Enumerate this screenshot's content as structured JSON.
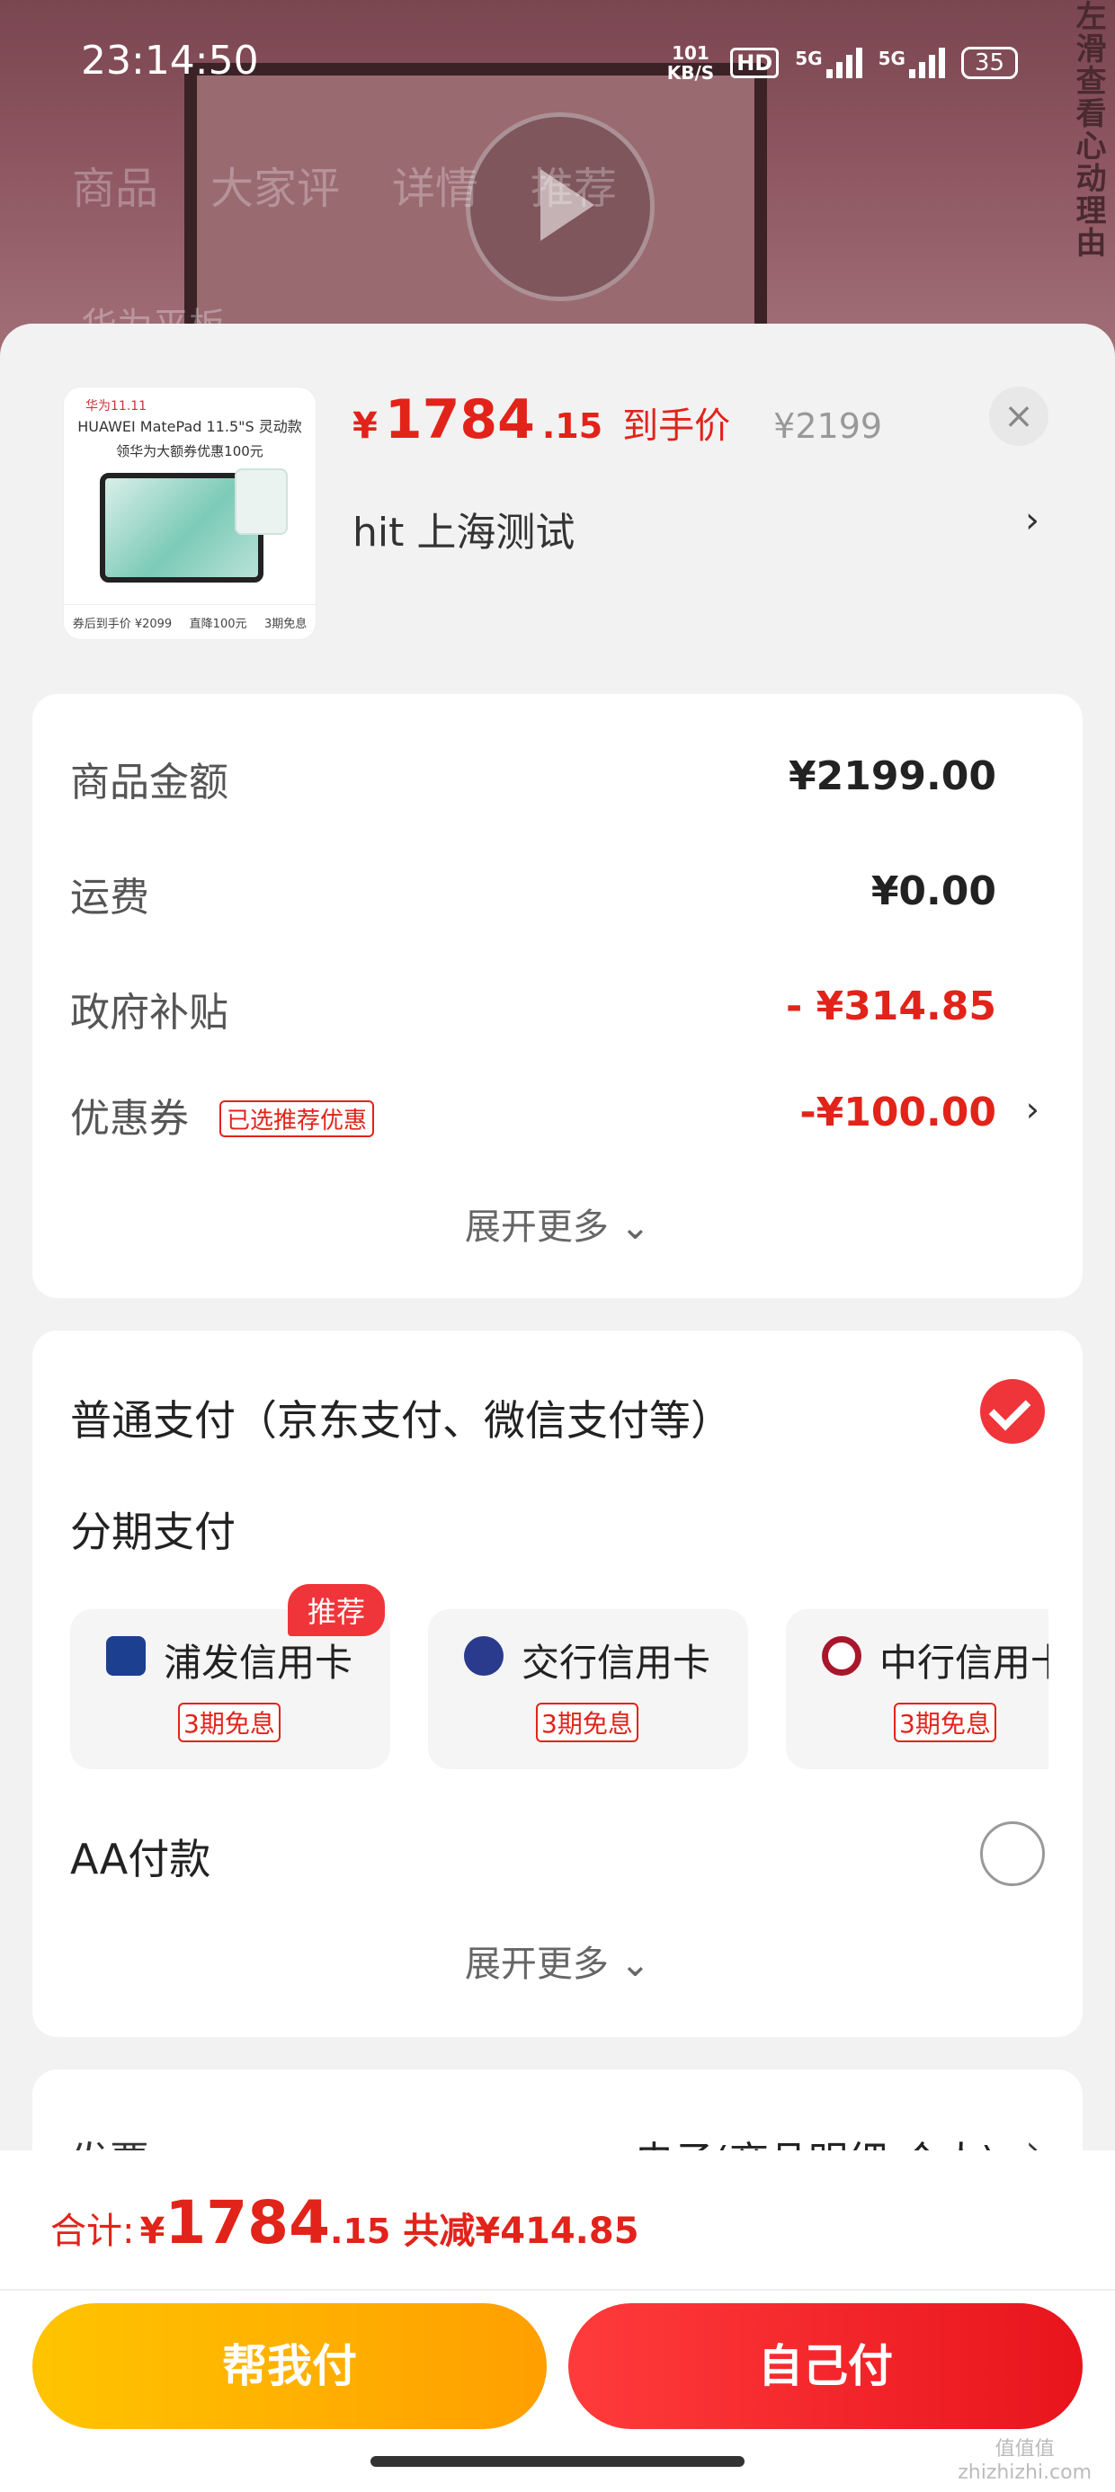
{
  "status_bar": {
    "time": "23:14:50",
    "net_speed_value": "101",
    "net_speed_unit": "KB/S",
    "hd_label": "HD",
    "signal1_label": "5G",
    "signal2_label": "5G",
    "battery": "35"
  },
  "background_page": {
    "nav_tabs": [
      "商品",
      "大家评",
      "详情",
      "推荐"
    ],
    "search_text": "华为平板",
    "side_banner": "左滑查看心动理由"
  },
  "product": {
    "thumb_tag": "华为11.11",
    "thumb_title": "HUAWEI MatePad 11.5\"S 灵动款",
    "thumb_subtitle": "领华为大额券优惠100元",
    "thumb_bottom": [
      "券后到手价 ¥2099",
      "直降100元",
      "3期免息"
    ],
    "price_symbol": "¥",
    "price_int": "1784",
    "price_dec": ".15",
    "price_label": "到手价",
    "original_price": "¥2199",
    "address": "hit  上海测试"
  },
  "summary": {
    "rows": [
      {
        "label": "商品金额",
        "value": "¥2199.00"
      },
      {
        "label": "运费",
        "value": "¥0.00"
      },
      {
        "label": "政府补贴",
        "value": "- ¥314.85"
      },
      {
        "label": "优惠券",
        "value": "-¥100.00"
      }
    ],
    "coupon_badge": "已选推荐优惠",
    "expand_more": "展开更多"
  },
  "payment": {
    "normal_pay": "普通支付（京东支付、微信支付等）",
    "installment_title": "分期支付",
    "recommend_tag": "推荐",
    "banks": [
      {
        "name": "浦发信用卡",
        "tag": "3期免息"
      },
      {
        "name": "交行信用卡",
        "tag": "3期免息"
      },
      {
        "name": "中行信用卡",
        "tag": "3期免息"
      }
    ],
    "aa_pay": "AA付款",
    "expand_more": "展开更多"
  },
  "invoice": {
    "label": "发票",
    "value": "电子(商品明细-个人)"
  },
  "footer": {
    "total_label": "合计:",
    "total_symbol": "¥",
    "total_int": "1784",
    "total_dec": ".15",
    "saved": "共减¥414.85",
    "help_pay": "帮我付",
    "self_pay": "自己付"
  },
  "watermark": "值值值\nzhizhizhi.com",
  "colors": {
    "accent_red": "#e2231a",
    "help_button": "#ffb300",
    "self_button": "#f0353a"
  }
}
